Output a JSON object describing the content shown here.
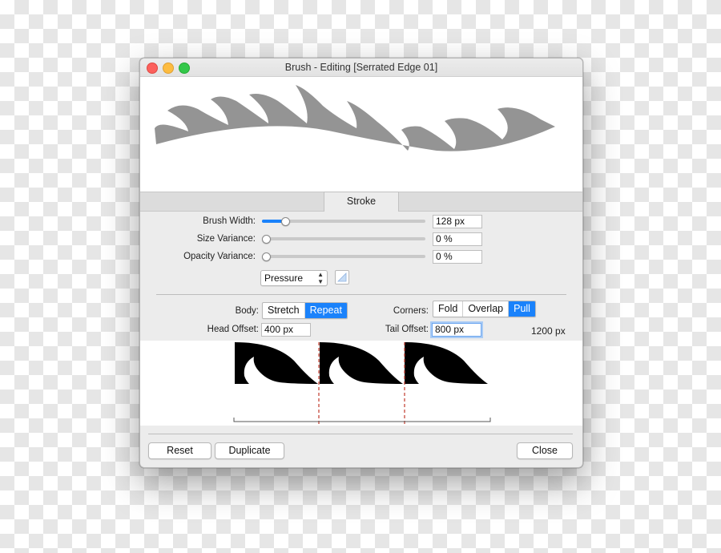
{
  "window": {
    "title": "Brush - Editing [Serrated Edge 01]"
  },
  "tabs": [
    {
      "label": "Stroke",
      "selected": true
    }
  ],
  "sliders": [
    {
      "label": "Brush Width:",
      "value": "128 px",
      "fraction": 0.14
    },
    {
      "label": "Size Variance:",
      "value": "0 %",
      "fraction": 0.0
    },
    {
      "label": "Opacity Variance:",
      "value": "0 %",
      "fraction": 0.0
    }
  ],
  "pressure_select": {
    "value": "Pressure",
    "icon": "up-down-chevron-icon"
  },
  "curve_icon": "pressure-curve-icon",
  "body": {
    "label": "Body:",
    "options": [
      {
        "label": "Stretch",
        "selected": false
      },
      {
        "label": "Repeat",
        "selected": true
      }
    ]
  },
  "corners": {
    "label": "Corners:",
    "options": [
      {
        "label": "Fold",
        "selected": false
      },
      {
        "label": "Overlap",
        "selected": false
      },
      {
        "label": "Pull",
        "selected": true
      }
    ]
  },
  "head_offset": {
    "label": "Head Offset:",
    "value": "400 px"
  },
  "tail_offset": {
    "label": "Tail Offset:",
    "value": "800 px"
  },
  "brush_length": "1200 px",
  "buttons": {
    "reset": "Reset",
    "duplicate": "Duplicate",
    "close": "Close"
  },
  "colors": {
    "accent": "#1a82fb",
    "preview_stroke": "#949494",
    "source_shape": "#000000",
    "guide_line": "#c0392b"
  }
}
